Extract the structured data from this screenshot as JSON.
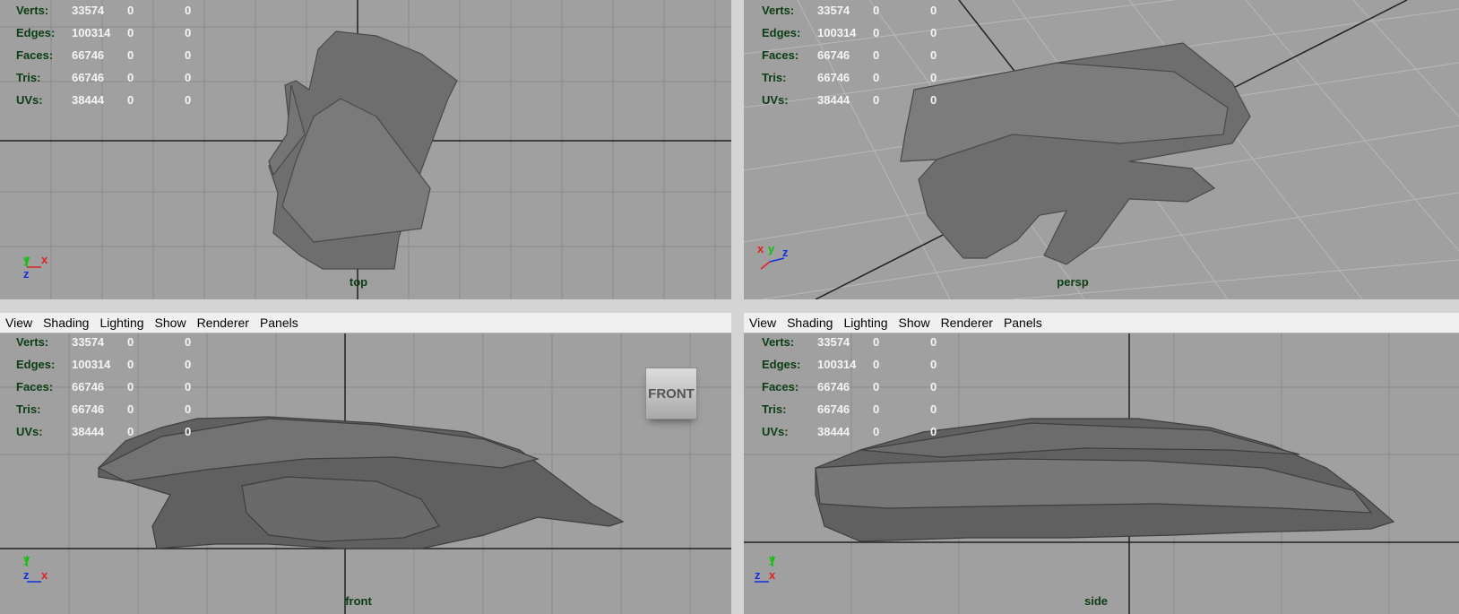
{
  "menu": [
    "View",
    "Shading",
    "Lighting",
    "Show",
    "Renderer",
    "Panels"
  ],
  "hud": [
    {
      "label": "Verts:",
      "values": [
        "33574",
        "0",
        "0"
      ]
    },
    {
      "label": "Edges:",
      "values": [
        "100314",
        "0",
        "0"
      ]
    },
    {
      "label": "Faces:",
      "values": [
        "66746",
        "0",
        "0"
      ]
    },
    {
      "label": "Tris:",
      "values": [
        "66746",
        "0",
        "0"
      ]
    },
    {
      "label": "UVs:",
      "values": [
        "38444",
        "0",
        "0"
      ]
    }
  ],
  "viewports": {
    "top": {
      "camera": "top",
      "axes": [
        "y",
        "x",
        "z"
      ]
    },
    "persp": {
      "camera": "persp",
      "axes": [
        "x",
        "y",
        "z"
      ]
    },
    "front": {
      "camera": "front",
      "axes": [
        "y",
        "z",
        "x"
      ]
    },
    "side": {
      "camera": "side",
      "axes": [
        "y",
        "z",
        "x"
      ]
    }
  },
  "viewcube": {
    "label": "FRONT"
  },
  "colors": {
    "viewport_bg": "#a0a0a0",
    "grid": "#8a8a8a",
    "origin": "#202020",
    "hud_label": "#0b3d14",
    "hud_value": "#f4f4f4",
    "mesh": "#6e6e6e",
    "axis_x": "#e02020",
    "axis_y": "#10c010",
    "axis_z": "#1030e0"
  }
}
